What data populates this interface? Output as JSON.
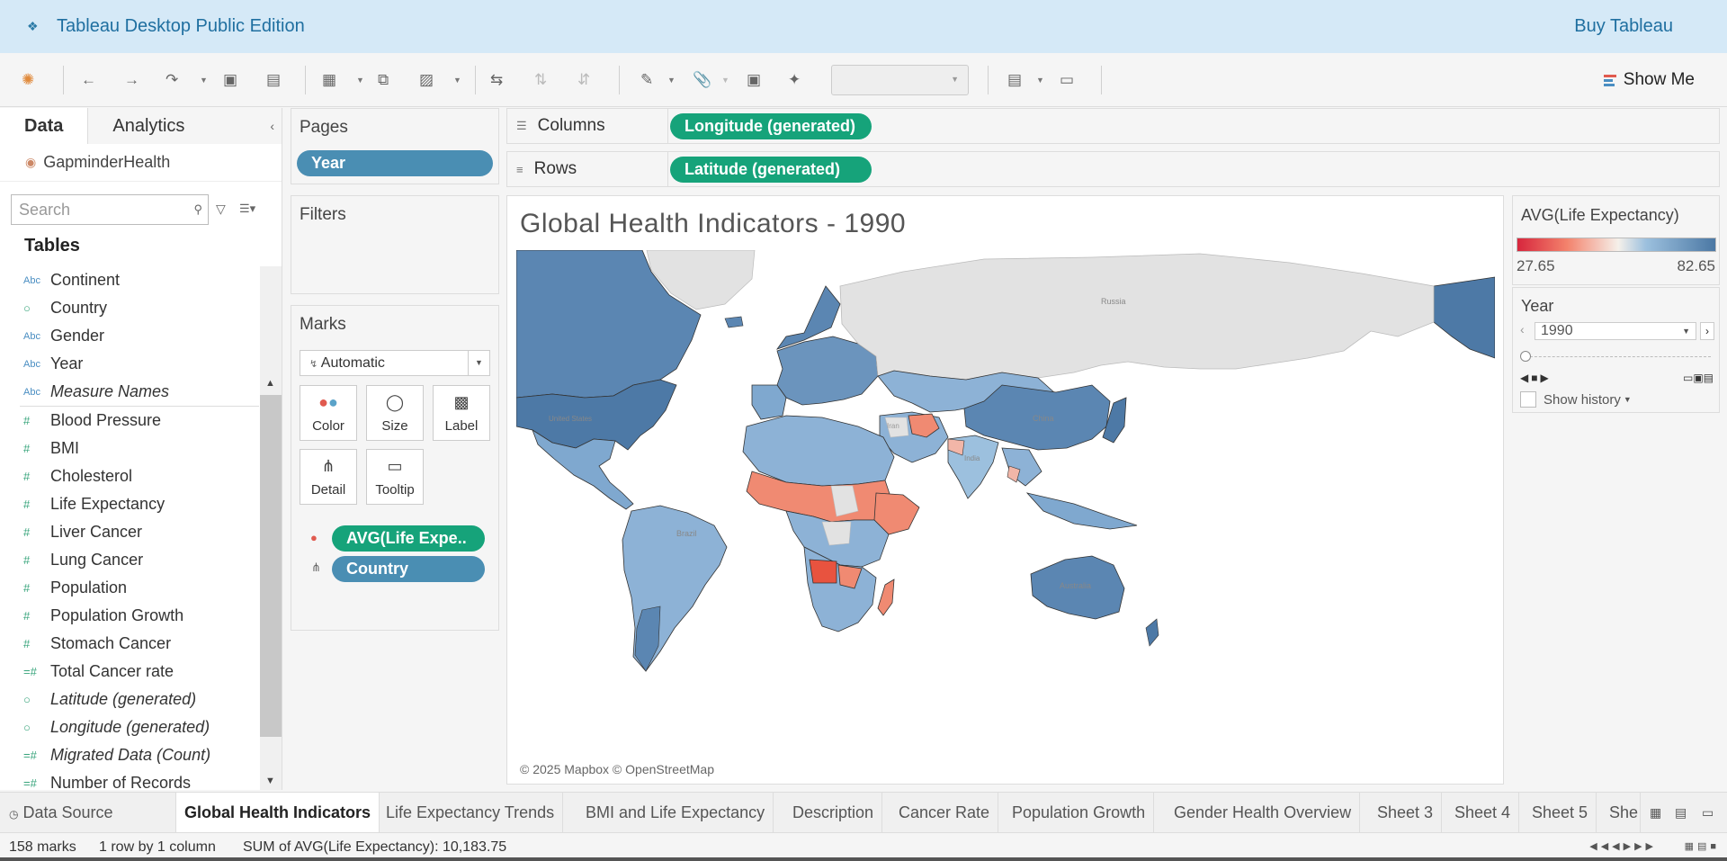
{
  "app": {
    "title": "Tableau Desktop Public Edition",
    "buy_label": "Buy Tableau"
  },
  "toolbar": {
    "show_me_label": "Show Me"
  },
  "data_pane": {
    "tab_data": "Data",
    "tab_analytics": "Analytics",
    "datasource": "GapminderHealth",
    "search_placeholder": "Search",
    "tables_heading": "Tables",
    "dimensions": [
      {
        "name": "Continent",
        "icon": "Abc",
        "italic": false
      },
      {
        "name": "Country",
        "icon": "globe",
        "italic": false
      },
      {
        "name": "Gender",
        "icon": "Abc",
        "italic": false
      },
      {
        "name": "Year",
        "icon": "Abc",
        "italic": false
      },
      {
        "name": "Measure Names",
        "icon": "Abc",
        "italic": true
      }
    ],
    "measures": [
      {
        "name": "Blood Pressure",
        "icon": "#",
        "italic": false
      },
      {
        "name": "BMI",
        "icon": "#",
        "italic": false
      },
      {
        "name": "Cholesterol",
        "icon": "#",
        "italic": false
      },
      {
        "name": "Life Expectancy",
        "icon": "#",
        "italic": false
      },
      {
        "name": "Liver Cancer",
        "icon": "#",
        "italic": false
      },
      {
        "name": "Lung Cancer",
        "icon": "#",
        "italic": false
      },
      {
        "name": "Population",
        "icon": "#",
        "italic": false
      },
      {
        "name": "Population Growth",
        "icon": "#",
        "italic": false
      },
      {
        "name": "Stomach Cancer",
        "icon": "#",
        "italic": false
      },
      {
        "name": "Total Cancer rate",
        "icon": "=#",
        "italic": false
      },
      {
        "name": "Latitude (generated)",
        "icon": "globe",
        "italic": true
      },
      {
        "name": "Longitude (generated)",
        "icon": "globe",
        "italic": true
      },
      {
        "name": "Migrated Data (Count)",
        "icon": "=#",
        "italic": true
      },
      {
        "name": "Number of Records",
        "icon": "=#",
        "italic": false
      }
    ]
  },
  "pages": {
    "title": "Pages",
    "pill": "Year"
  },
  "filters": {
    "title": "Filters"
  },
  "marks": {
    "title": "Marks",
    "type": "Automatic",
    "buttons": [
      "Color",
      "Size",
      "Label",
      "Detail",
      "Tooltip"
    ],
    "pill_color": "AVG(Life Expe..",
    "pill_detail": "Country"
  },
  "shelves": {
    "columns_label": "Columns",
    "columns_pill": "Longitude (generated)",
    "rows_label": "Rows",
    "rows_pill": "Latitude (generated)"
  },
  "viz": {
    "title": "Global Health Indicators - 1990",
    "attribution": "© 2025 Mapbox © OpenStreetMap",
    "map_labels": {
      "russia": "Russia",
      "iran": "Iran",
      "india": "India",
      "china": "China",
      "brazil": "Brazil",
      "australia": "Australia",
      "united_states": "United States"
    }
  },
  "legend": {
    "title": "AVG(Life Expectancy)",
    "min": "27.65",
    "max": "82.65",
    "colors": {
      "low": "#d7263d",
      "mid": "#f5f0ea",
      "high": "#4b78a4"
    }
  },
  "page_control": {
    "title": "Year",
    "value": "1990",
    "show_history": "Show history"
  },
  "sheet_tabs": {
    "data_source": "Data Source",
    "sheets": [
      "Global Health Indicators",
      "Life Expectancy Trends",
      "BMI and Life Expectancy",
      "Description",
      "Cancer Rate",
      "Population Growth",
      "Gender Health Overview",
      "Sheet 3",
      "Sheet 4",
      "Sheet 5",
      "She"
    ],
    "active": "Global Health Indicators"
  },
  "status": {
    "marks": "158 marks",
    "layout": "1 row by 1 column",
    "sum": "SUM of AVG(Life Expectancy): 10,183.75"
  }
}
